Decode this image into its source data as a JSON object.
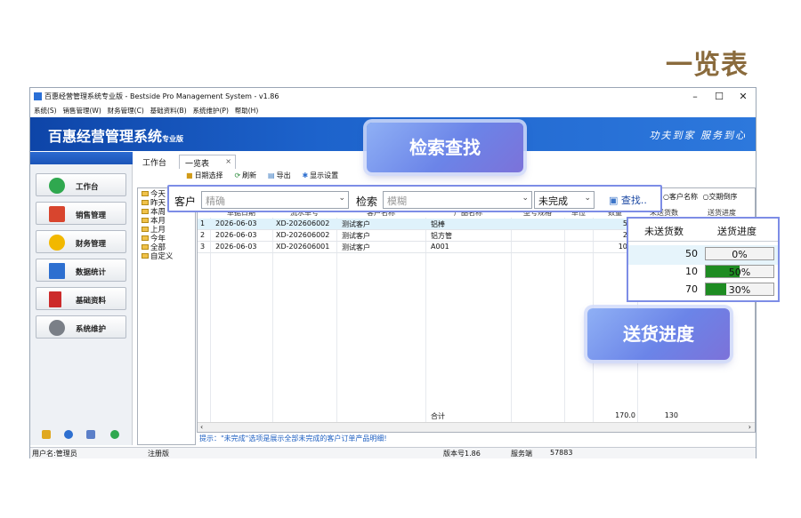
{
  "page_title": "一览表",
  "window": {
    "title": "百惠经营管理系统专业版 - Bestside Pro Management System - v1.86",
    "controls": [
      "–",
      "☐",
      "✕"
    ]
  },
  "menu": [
    "系统(S)",
    "销售管理(W)",
    "财务管理(C)",
    "基础资料(B)",
    "系统维护(P)",
    "帮助(H)"
  ],
  "banner": {
    "brand": "百惠经营管理系统",
    "brand_suffix": "专业版",
    "slogan": "功夫到家 服务到心"
  },
  "sidebar": {
    "items": [
      {
        "label": "工作台",
        "icon": "check-circle-icon",
        "color": "#2fa84f"
      },
      {
        "label": "销售管理",
        "icon": "house-icon",
        "color": "#d8452e"
      },
      {
        "label": "财务管理",
        "icon": "star-icon",
        "color": "#f2b800"
      },
      {
        "label": "数据统计",
        "icon": "bar-chart-icon",
        "color": "#2d6fd0"
      },
      {
        "label": "基础资料",
        "icon": "book-icon",
        "color": "#cc2a2a"
      },
      {
        "label": "系统维护",
        "icon": "gear-icon",
        "color": "#7a7f87"
      }
    ]
  },
  "tabs": {
    "work": "工作台",
    "list": "一览表",
    "close": "×"
  },
  "toolbar": {
    "date_select": "日期选择",
    "refresh": "刷新",
    "export": "导出",
    "display_settings": "显示设置"
  },
  "tree": [
    "今天",
    "昨天",
    "本周",
    "本月",
    "上月",
    "今年",
    "全部",
    "自定义"
  ],
  "search": {
    "customer_label": "客户",
    "customer_mode": "精确",
    "search_label": "检索",
    "search_mode": "模糊",
    "status": "未完成",
    "button": "查找.."
  },
  "right_options": [
    "客户名称",
    "交期倒序"
  ],
  "grid": {
    "columns": [
      "",
      "单据日期",
      "流水单号",
      "客户名称",
      "产品名称",
      "型号规格",
      "单位",
      "数量",
      "未送货数",
      "送货进度"
    ],
    "rows": [
      {
        "no": "1",
        "date": "2026-06-03",
        "serial": "XD-202606002",
        "customer": "测试客户",
        "product": "铝棒",
        "qty": "50"
      },
      {
        "no": "2",
        "date": "2026-06-03",
        "serial": "XD-202606002",
        "customer": "测试客户",
        "product": "铝方管",
        "qty": "20"
      },
      {
        "no": "3",
        "date": "2026-06-03",
        "serial": "XD-202606001",
        "customer": "测试客户",
        "product": "A001",
        "qty": "100"
      }
    ],
    "total_label": "合计",
    "total_qty": "170.0",
    "total_undelivered": "130"
  },
  "hint": "提示：\"未完成\"选项是展示全部未完成的客户订单产品明细!",
  "statusbar": {
    "user": "用户名:管理员",
    "reg": "注册版",
    "version": "版本号1.86",
    "server_label": "服务端",
    "server_port": "57883"
  },
  "callouts": {
    "search": "检索查找",
    "progress": "送货进度"
  },
  "progress_panel": {
    "headers": [
      "未送货数",
      "送货进度"
    ],
    "rows": [
      {
        "undelivered": "50",
        "progress": 0,
        "progress_text": "0%"
      },
      {
        "undelivered": "10",
        "progress": 0.5,
        "progress_text": "50%"
      },
      {
        "undelivered": "70",
        "progress": 0.3,
        "progress_text": "30%"
      }
    ]
  }
}
